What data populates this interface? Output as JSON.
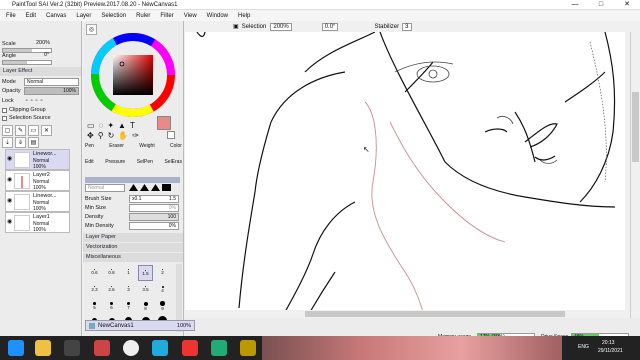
{
  "title": "PaintTool SAI Ver.2 (32bit) Preview.2017.08.20 - NewCanvas1",
  "window_buttons": [
    "—",
    "□",
    "✕"
  ],
  "menu": [
    "File",
    "Edit",
    "Canvas",
    "Layer",
    "Selection",
    "Ruler",
    "Filter",
    "View",
    "Window",
    "Help"
  ],
  "left_panel": {
    "scale_label": "Scale",
    "scale_value": "200%",
    "angle_label": "Angle",
    "angle_value": "0°",
    "layer_effect": "Layer Effect",
    "mode_label": "Mode",
    "mode_value": "Normal",
    "opacity_label": "Opacity",
    "opacity_value": "100%",
    "lock_label": "Lock",
    "clipping_group": "Clipping Group",
    "selection_source": "Selection Source",
    "layers": [
      {
        "name": "Linewor...",
        "mode": "Normal",
        "opacity": "100%",
        "selected": true
      },
      {
        "name": "Layer2",
        "mode": "Normal",
        "opacity": "100%",
        "selected": false
      },
      {
        "name": "Linewor...",
        "mode": "Normal",
        "opacity": "100%",
        "selected": false
      },
      {
        "name": "Layer1",
        "mode": "Normal",
        "opacity": "100%",
        "selected": false
      }
    ]
  },
  "tools": {
    "row1": [
      "Pen",
      "Eraser",
      "Weight",
      "Color"
    ],
    "row2": [
      "Edit",
      "Pressure",
      "SelPen",
      "SelEras"
    ],
    "blend": "Normal",
    "brush_size_label": "Brush Size",
    "brush_size_mult": "x0.1",
    "brush_size_value": "1.5",
    "min_size_label": "Min Size",
    "min_size_value": "0%",
    "density_label": "Density",
    "density_value": "100",
    "min_density_label": "Min Density",
    "min_density_value": "0%",
    "sections": [
      "Layer Paper",
      "Vectorization",
      "Miscellaneous"
    ],
    "brush_sizes": [
      "0.6",
      "0.8",
      "1",
      "1.5",
      "2",
      "2.3",
      "2.6",
      "3",
      "3.5",
      "4",
      "5",
      "6",
      "7",
      "8",
      "9",
      "10",
      "12",
      "14",
      "16",
      "20"
    ],
    "selected_brush": "1.5"
  },
  "canvas_toolbar": {
    "selection_label": "Selection",
    "zoom": "200%",
    "angle": "0.0°",
    "stabilizer_label": "Stabilizer",
    "stabilizer_value": "3"
  },
  "status": {
    "canvas_name": "NewCanvas1",
    "canvas_zoom": "100%",
    "memory_label": "Memory usage",
    "memory_value": "17% (30%)",
    "drive_label": "Drive Space",
    "drive_value": "48%"
  },
  "taskbar": {
    "lang": "ENG",
    "time": "20:13",
    "date": "29/11/2021"
  },
  "colors": {
    "accent": "#e88a8a",
    "sel_layer": "#d9d9ef"
  }
}
